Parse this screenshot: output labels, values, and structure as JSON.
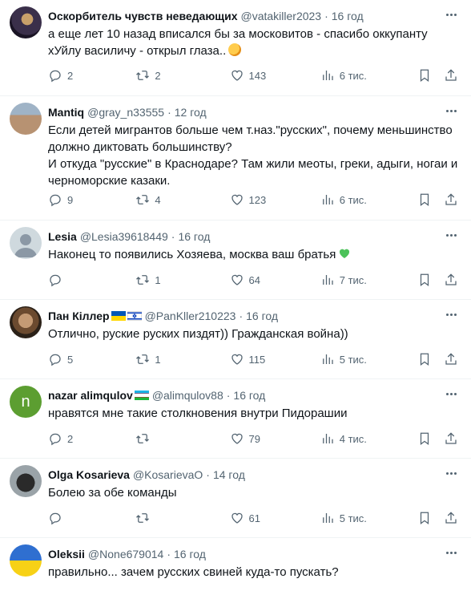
{
  "tweets": [
    {
      "name": "Оскорбитель чувств неведающих",
      "handle": "@vatakiller2023",
      "time": "16 год",
      "text": "а еще лет 10 назад вписался бы за московитов - спасибо оккупанту хУйлу василичу - открыл глаза..",
      "reply_icon": "reply-icon",
      "retweet_icon": "retweet-icon",
      "like_icon": "heart-icon",
      "views_icon": "views-icon",
      "replies": "2",
      "retweets": "2",
      "likes": "143",
      "views": "6 тис."
    },
    {
      "name": "Mantiq",
      "handle": "@gray_n33555",
      "time": "12 год",
      "text": "Если детей мигрантов больше чем т.наз.\"русских\", почему меньшинство должно диктовать большинству?\nИ откуда \"русские\" в Краснодаре? Там жили меоты, греки, адыги, ногаи и черноморские казаки.",
      "replies": "9",
      "retweets": "4",
      "likes": "123",
      "views": "6 тис."
    },
    {
      "name": "Lesia",
      "handle": "@Lesia39618449",
      "time": "16 год",
      "text": "Наконец то появились Хозяева, москва ваш братья",
      "replies": "",
      "retweets": "1",
      "likes": "64",
      "views": "7 тис."
    },
    {
      "name": "Пан Кіллер",
      "handle": "@PanKller210223",
      "time": "16 год",
      "text": "Отлично, руские руских пиздят)) Гражданская война))",
      "replies": "5",
      "retweets": "1",
      "likes": "115",
      "views": "5 тис."
    },
    {
      "name": "nazar alimqulov",
      "handle": "@alimqulov88",
      "time": "16 год",
      "avatar_letter": "n",
      "text": "нравятся мне такие столкновения внутри Пидорашии",
      "replies": "2",
      "retweets": "",
      "likes": "79",
      "views": "4 тис."
    },
    {
      "name": "Olga Kosarieva",
      "handle": "@KosarievaO",
      "time": "14 год",
      "text": "Болею за обе команды",
      "replies": "",
      "retweets": "",
      "likes": "61",
      "views": "5 тис."
    },
    {
      "name": "Oleksii",
      "handle": "@None679014",
      "time": "16 год",
      "text": "правильно... зачем русских свиней куда-то пускать?"
    }
  ],
  "colors": {
    "text": "#0f1419",
    "muted": "#536471",
    "divider": "#eff3f4",
    "heart_emoji": "#4cc25a",
    "avatar_green": "#5c9e31"
  },
  "separator": "·"
}
